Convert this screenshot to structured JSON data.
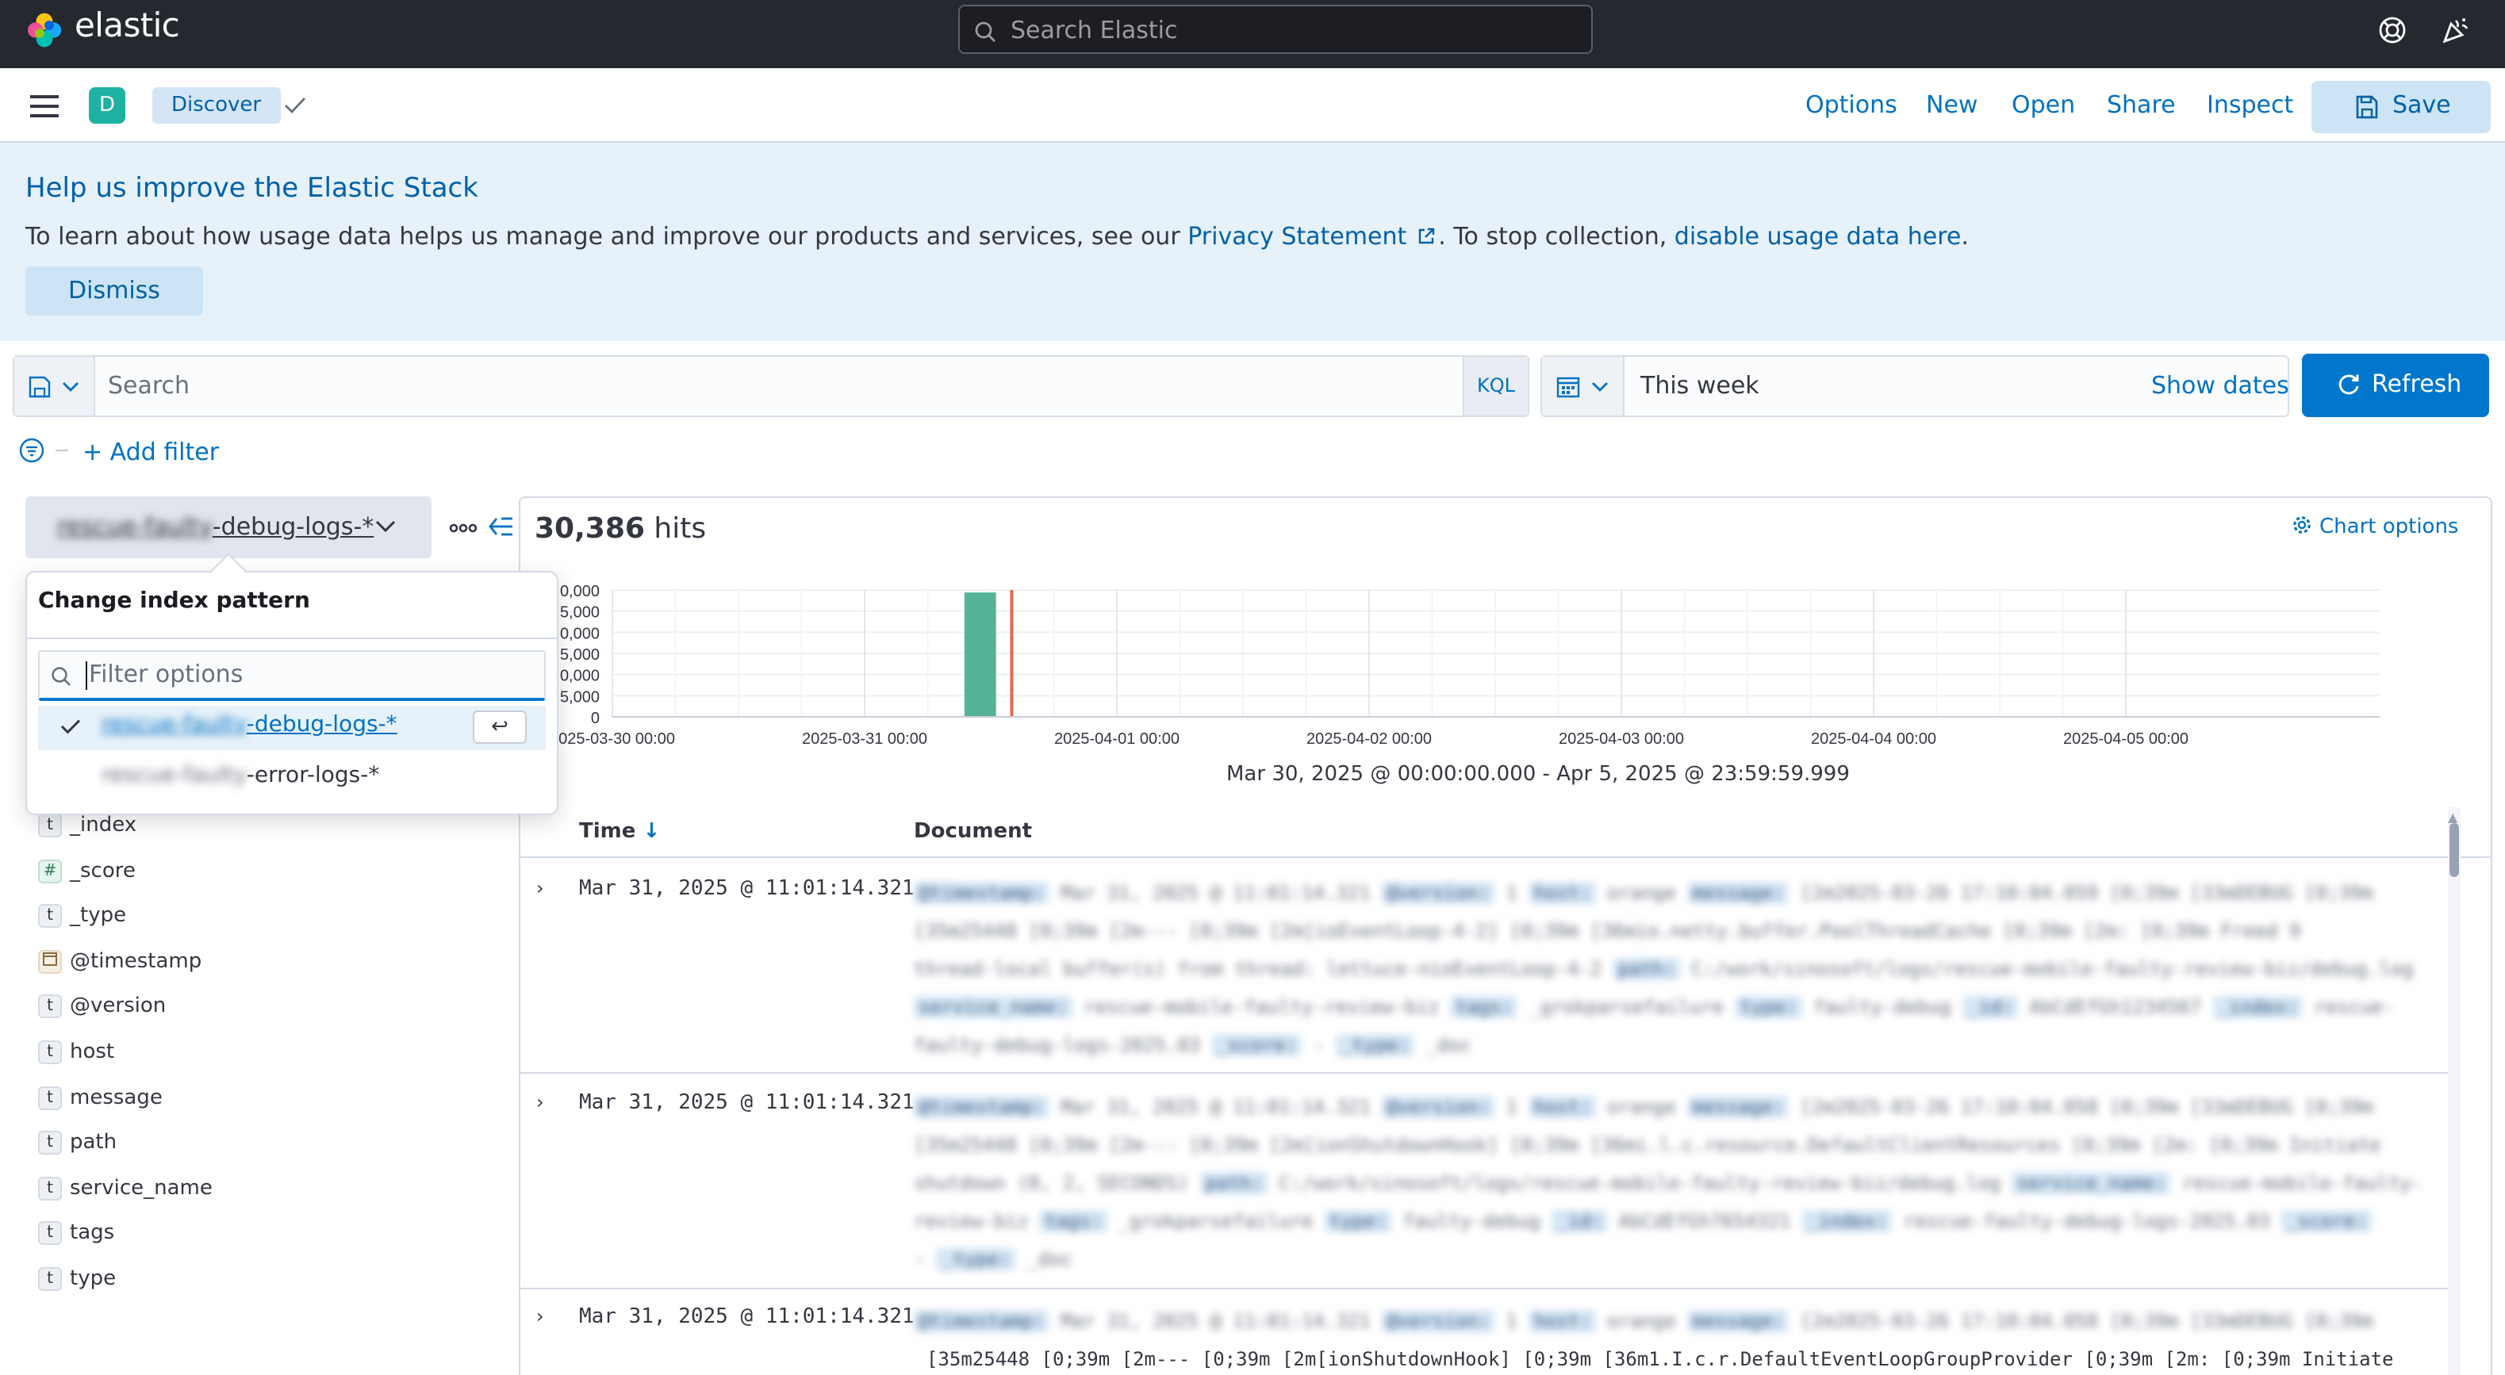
{
  "header": {
    "brand": "elastic",
    "search_placeholder": "Search Elastic",
    "icons": [
      "help-icon",
      "newsfeed-icon"
    ]
  },
  "appbar": {
    "space_initial": "D",
    "breadcrumb": "Discover",
    "nav": [
      "Options",
      "New",
      "Open",
      "Share",
      "Inspect"
    ],
    "save_label": "Save"
  },
  "callout": {
    "title": "Help us improve the Elastic Stack",
    "text_before": "To learn about how usage data helps us manage and improve our products and services, see our ",
    "privacy_link": "Privacy Statement",
    "text_middle": ". To stop collection, ",
    "disable_link": "disable usage data here",
    "text_after": ".",
    "dismiss_label": "Dismiss"
  },
  "querybar": {
    "placeholder": "Search",
    "language": "KQL",
    "time_value": "This week",
    "show_dates": "Show dates",
    "refresh_label": "Refresh",
    "add_filter": "+ Add filter"
  },
  "index_pattern": {
    "selected_prefix": "rescue-faulty",
    "selected_suffix": "-debug-logs-*",
    "popover_title": "Change index pattern",
    "filter_placeholder": "Filter options",
    "options": [
      {
        "prefix": "rescue-faulty",
        "suffix": "-debug-logs-*",
        "selected": true
      },
      {
        "prefix": "rescue-faulty",
        "suffix": "-error-logs-*",
        "selected": false
      }
    ],
    "enter_key": "↩"
  },
  "fields": [
    {
      "type": "t",
      "name": "_index"
    },
    {
      "type": "#",
      "name": "_score"
    },
    {
      "type": "t",
      "name": "_type"
    },
    {
      "type": "date",
      "name": "@timestamp"
    },
    {
      "type": "t",
      "name": "@version"
    },
    {
      "type": "t",
      "name": "host"
    },
    {
      "type": "t",
      "name": "message"
    },
    {
      "type": "t",
      "name": "path"
    },
    {
      "type": "t",
      "name": "service_name"
    },
    {
      "type": "t",
      "name": "tags"
    },
    {
      "type": "t",
      "name": "type"
    }
  ],
  "results": {
    "hits_count": "30,386",
    "hits_label": "hits",
    "chart_options": "Chart options",
    "date_range": "Mar 30, 2025 @ 00:00:00.000 - Apr 5, 2025 @ 23:59:59.999",
    "col_time": "Time",
    "col_document": "Document",
    "rows": [
      {
        "time": "Mar 31, 2025 @ 11:01:14.321"
      },
      {
        "time": "Mar 31, 2025 @ 11:01:14.321"
      },
      {
        "time": "Mar 31, 2025 @ 11:01:14.321",
        "visible_line": "[35m25448 [0;39m  [2m--- [0;39m  [2m[ionShutdownHook] [0;39m  [36m1.I.c.r.DefaultEventLoopGroupProvider  [0;39m  [2m: [0;39m Initiate"
      }
    ]
  },
  "chart_data": {
    "type": "bar",
    "y_tick_labels": [
      "0,000",
      "5,000",
      "0,000",
      "5,000",
      "0,000",
      "5,000",
      "0"
    ],
    "x_tick_labels": [
      "2025-03-30 00:00",
      "2025-03-31 00:00",
      "2025-04-01 00:00",
      "2025-04-02 00:00",
      "2025-04-03 00:00",
      "2025-04-04 00:00",
      "2025-04-05 00:00"
    ],
    "bars": [
      {
        "x": "2025-03-31 11:00",
        "value": 30386
      }
    ],
    "ylim": [
      0,
      31000
    ],
    "bar_color": "#54b399",
    "now_marker_color": "#e7664c",
    "now_marker_x": "2025-03-31 14:00",
    "grid": true
  },
  "colors": {
    "header_bg": "#25282f",
    "accent": "#0077cc",
    "link": "#0071c2",
    "callout_bg": "#e6f1fa",
    "space_badge": "#1fb1a2"
  }
}
